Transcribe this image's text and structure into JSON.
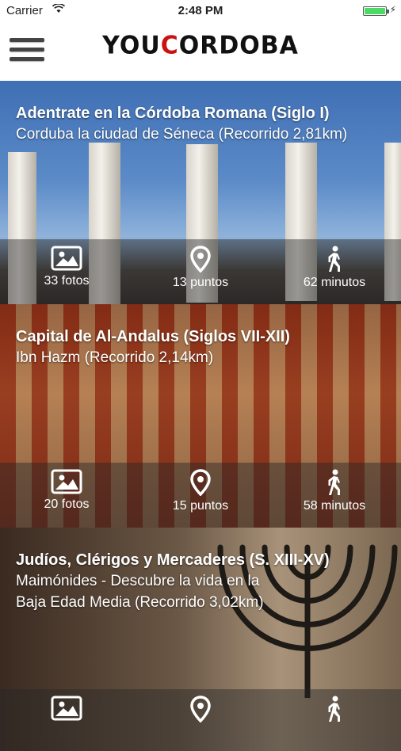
{
  "status_bar": {
    "carrier": "Carrier",
    "time": "2:48 PM",
    "battery_level": 1.0
  },
  "header": {
    "logo_prefix": "YOU",
    "logo_highlight": "C",
    "logo_suffix": "ORDOBA",
    "logo_accent_color": "#cc1111",
    "menu_icon": "hamburger-menu-icon"
  },
  "routes": [
    {
      "title": "Adentrate en la Córdoba Romana (Siglo I)",
      "subtitle": "Corduba la ciudad de Séneca (Recorrido 2,81km)",
      "photos": "33 fotos",
      "points": "13 puntos",
      "minutes": "62 minutos"
    },
    {
      "title": "Capital de Al-Andalus (Siglos VII-XII)",
      "subtitle": "Ibn Hazm (Recorrido 2,14km)",
      "photos": "20 fotos",
      "points": "15 puntos",
      "minutes": "58 minutos"
    },
    {
      "title": "Judíos, Clérigos y Mercaderes (S. XIII-XV)",
      "subtitle": "Maimónides - Descubre la vida en la Baja Edad Media (Recorrido 3,02km)",
      "photos": "",
      "points": "",
      "minutes": ""
    }
  ],
  "icons": {
    "photos": "photo-icon",
    "points": "map-pin-icon",
    "minutes": "walking-icon"
  }
}
